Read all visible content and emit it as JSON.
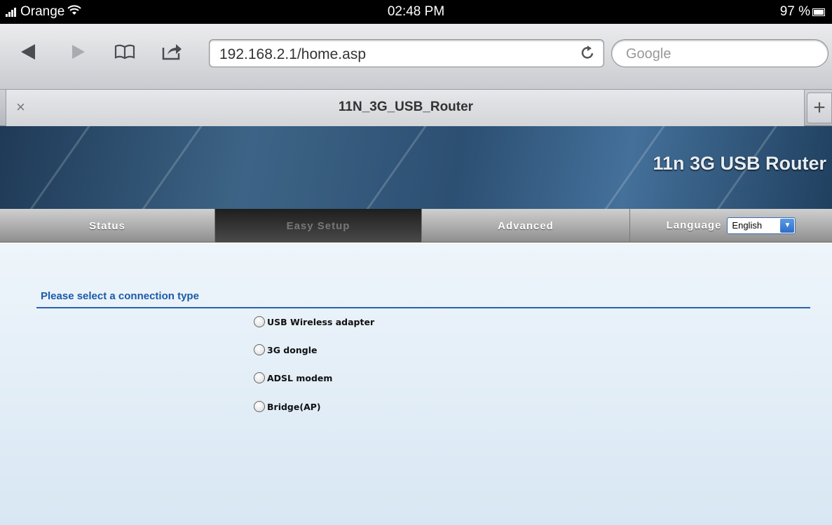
{
  "status_bar": {
    "carrier": "Orange",
    "time": "02:48 PM",
    "battery": "97 %",
    "icons": [
      "signal-bars-icon",
      "wifi-icon",
      "battery-icon"
    ]
  },
  "browser": {
    "url": "192.168.2.1/home.asp",
    "search_placeholder": "Google",
    "tab_title": "11N_3G_USB_Router",
    "tab_close": "×",
    "new_tab": "+",
    "icons": [
      "back-icon",
      "forward-icon",
      "bookmarks-icon",
      "share-icon",
      "reload-icon"
    ]
  },
  "router": {
    "brand": "11n 3G USB Router",
    "nav": {
      "status": "Status",
      "easy_setup": "Easy Setup",
      "advanced": "Advanced",
      "language_label": "Language",
      "language_value": "English",
      "active": "easy_setup"
    },
    "heading": "Please select a connection type",
    "options": [
      "USB Wireless adapter",
      "3G dongle",
      "ADSL modem",
      "Bridge(AP)"
    ]
  }
}
